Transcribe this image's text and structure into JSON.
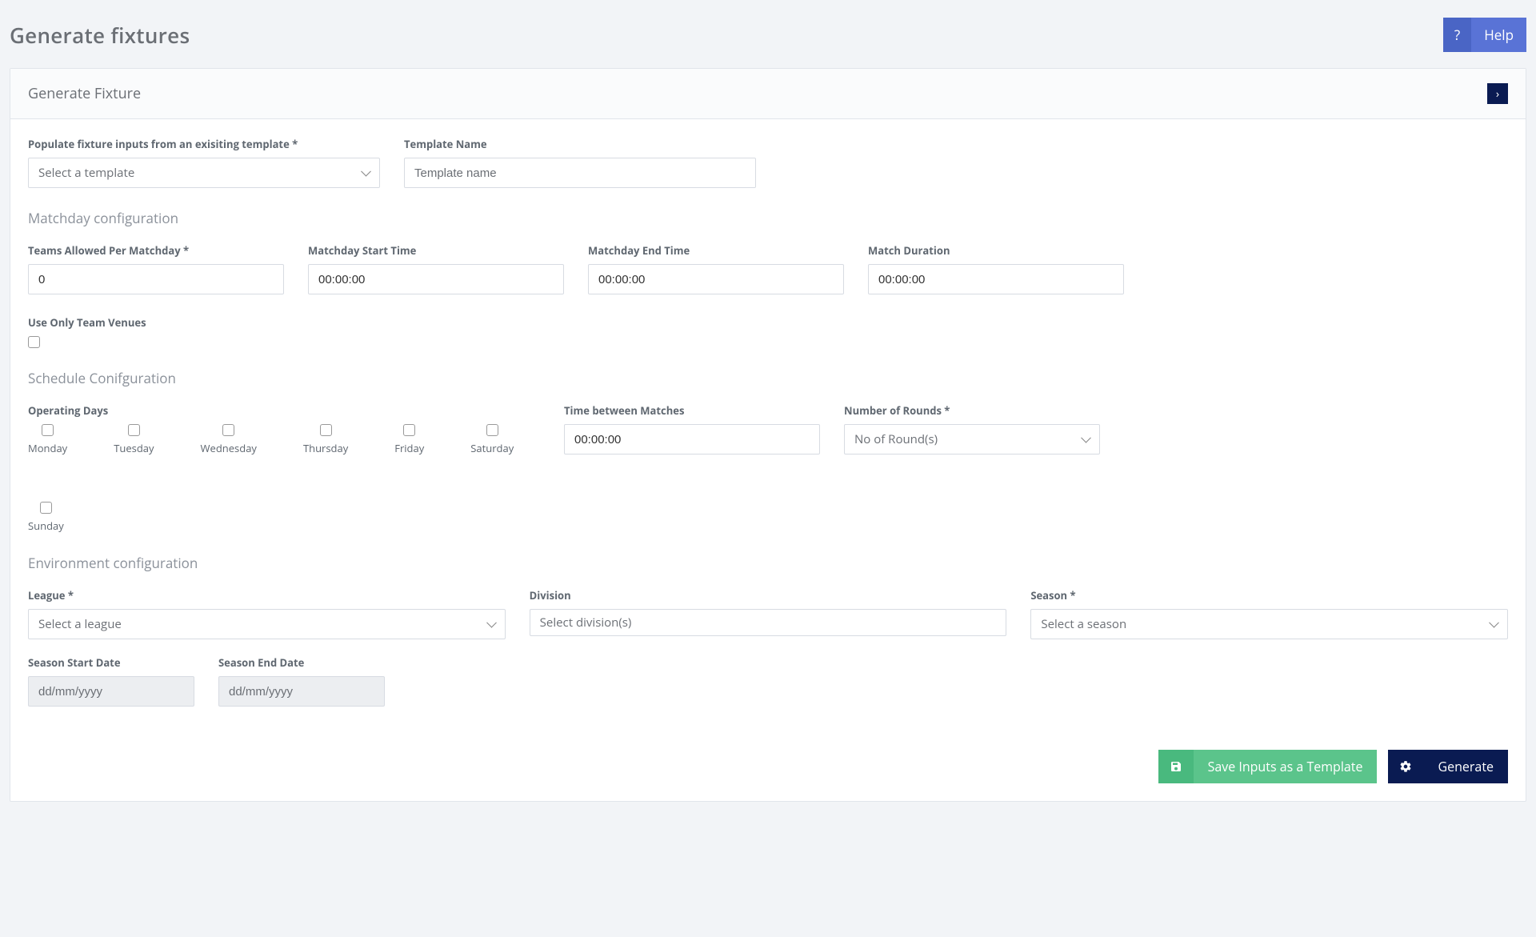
{
  "page": {
    "title": "Generate fixtures"
  },
  "help": {
    "qmark": "?",
    "label": "Help"
  },
  "card": {
    "title": "Generate Fixture"
  },
  "template": {
    "populate_label": "Populate fixture inputs from an exisiting template *",
    "select_placeholder": "Select a template",
    "name_label": "Template Name",
    "name_placeholder": "Template name"
  },
  "matchday": {
    "section": "Matchday configuration",
    "teams_label": "Teams Allowed Per Matchday *",
    "teams_value": "0",
    "start_label": "Matchday Start Time",
    "start_value": "00:00:00",
    "end_label": "Matchday End Time",
    "end_value": "00:00:00",
    "duration_label": "Match Duration",
    "duration_value": "00:00:00",
    "venues_label": "Use Only Team Venues"
  },
  "schedule": {
    "section": "Schedule Conifguration",
    "days_label": "Operating Days",
    "days": [
      "Monday",
      "Tuesday",
      "Wednesday",
      "Thursday",
      "Friday",
      "Saturday",
      "Sunday"
    ],
    "between_label": "Time between Matches",
    "between_value": "00:00:00",
    "rounds_label": "Number of Rounds *",
    "rounds_placeholder": "No of Round(s)"
  },
  "env": {
    "section": "Environment configuration",
    "league_label": "League *",
    "league_placeholder": "Select a league",
    "division_label": "Division",
    "division_placeholder": "Select division(s)",
    "season_label": "Season *",
    "season_placeholder": "Select a season",
    "start_date_label": "Season Start Date",
    "start_date_placeholder": "dd/mm/yyyy",
    "end_date_label": "Season End Date",
    "end_date_placeholder": "dd/mm/yyyy"
  },
  "footer": {
    "save_label": "Save Inputs as a Template",
    "generate_label": "Generate"
  }
}
